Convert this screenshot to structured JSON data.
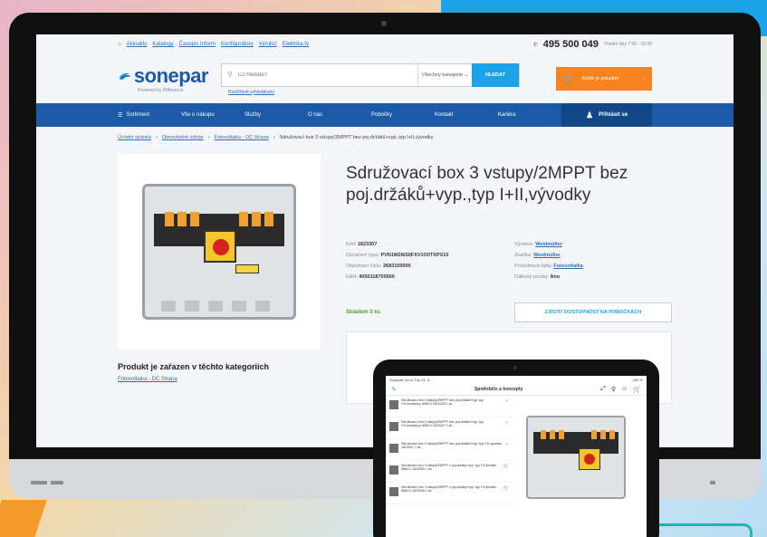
{
  "topbar": {
    "crumbs": [
      "Aktuality",
      "Katalogy",
      "Časopis Inform",
      "Konfigurátory",
      "Výrobci",
      "Elektrika.tv"
    ],
    "phone": "495 500 049",
    "hours": "Všední dny 7:00 - 16:00"
  },
  "header": {
    "logo": "sonepar",
    "logo_sub": "Powered by Difference",
    "search_placeholder": "Co hledáte?",
    "category_select": "Všechny kategorie",
    "search_button": "HLEDAT",
    "advanced_link": "Rozšířené vyhledávání",
    "cart": "Košík je prázdný"
  },
  "nav": {
    "items": [
      "Sortiment",
      "Vše o nákupu",
      "Služby",
      "O nás",
      "Pobočky",
      "Kontakt",
      "Kariéra"
    ],
    "login": "Přihlásit se"
  },
  "breadcrumb": [
    "Úvodní stránka",
    "Obnovitelné zdroje",
    "Fotovoltaika - DC Strana",
    "Sdružovací box 3 vstupy/2MPPT bez poj.držáků+vyp.,typ I+II,vývodky"
  ],
  "product": {
    "title": "Sdružovací box 3 vstupy/2MPPT bez poj.držáků+vyp.,typ I+II,vývodky",
    "specs": [
      {
        "label": "Kód:",
        "value": "1823307"
      },
      {
        "label": "Označení typu:",
        "value": "PVN1M2I6S0FXV1O0TXPX10"
      },
      {
        "label": "Objednací číslo:",
        "value": "2683150000"
      },
      {
        "label": "EAN:",
        "value": "4050118700060"
      }
    ],
    "specs_right": [
      {
        "label": "Výrobce:",
        "value": "Weidmüller"
      },
      {
        "label": "Značka:",
        "value": "Weidmüller"
      },
      {
        "label": "Produktová řada:",
        "value": "Fotovoltaika"
      },
      {
        "label": "Dálkový prodej:",
        "value": "Ano"
      }
    ],
    "stock": "Skladem 3 ks",
    "availability_button": "ZJISTIT DOSTUPNOST NA POBOČKÁCH",
    "categories_title": "Produkt je zařazen v těchto kategoriích",
    "category_link": "Fotovoltaika - DC Strana"
  },
  "tablet": {
    "status_left": "Sonepar 14:14  Thu 31. 3.",
    "status_right": "100 %",
    "title": "Spotřebiče a koncepty",
    "items": [
      "Sdružovací box 3 vstupy/2MPPT bez poj.držáků+vyp.,typ I+II,konektory WMC4 1823328 1 ks",
      "Sdružovací box 3 vstupy/2MPPT bez poj.držáků+vyp.,typ I+II,konektory WMC4 1823327 1 ks",
      "Sdružovací box 3 vstupy/2MPPT bez poj.držáků+vyp.,typ I+II,vývodky 1823307 1 ks",
      "Sdružovací box 3 vstupy/2MPPT s poj.držáky+vyp.,typ I+II,konekt. WMC4 1823309 1 ks",
      "Sdružovací box 3 vstupy/2MPPT s poj.držáky+vyp.,typ I+II,konekt. WMC4 1823308 1 ks"
    ]
  },
  "colors": {
    "brand_blue": "#1b5aa7",
    "accent_blue": "#1aa3e8",
    "cart_orange": "#f6831f",
    "stock_green": "#4aa43a"
  }
}
